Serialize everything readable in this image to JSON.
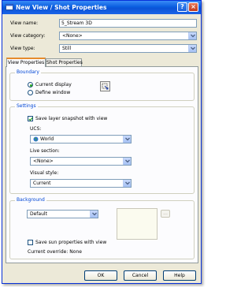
{
  "window": {
    "title": "New View / Shot Properties",
    "help_glyph": "?",
    "close_glyph": "×"
  },
  "fields": {
    "view_name_label": "View name:",
    "view_name_value": "5_Stream 3D",
    "view_category_label": "View category:",
    "view_category_value": "<None>",
    "view_type_label": "View type:",
    "view_type_value": "Still"
  },
  "tabs": [
    {
      "label": "View Properties",
      "active": true
    },
    {
      "label": "Shot Properties",
      "active": false
    }
  ],
  "boundary": {
    "title": "Boundary",
    "current_display": "Current display",
    "define_window": "Define window",
    "selected": "Current display"
  },
  "settings": {
    "title": "Settings",
    "save_layer_snapshot": "Save layer snapshot with view",
    "save_layer_snapshot_checked": true,
    "ucs_label": "UCS:",
    "ucs_value": "World",
    "live_section_label": "Live section:",
    "live_section_value": "<None>",
    "visual_style_label": "Visual style:",
    "visual_style_value": "Current"
  },
  "background": {
    "title": "Background",
    "value": "Default",
    "browse": "...",
    "save_sun_label": "Save sun properties with view",
    "save_sun_checked": false,
    "current_override": "Current override: None"
  },
  "buttons": {
    "ok": "OK",
    "cancel": "Cancel",
    "help": "Help"
  },
  "colors": {
    "title_bar": "#0a5ee0",
    "group_title": "#0046d5",
    "dialog_bg": "#ece9d8",
    "tab_accent": "#e68b2c"
  },
  "icons": [
    "dialog-icon",
    "help-icon",
    "close-icon",
    "window-select-icon",
    "world-globe-icon",
    "chevron-down-icon"
  ]
}
